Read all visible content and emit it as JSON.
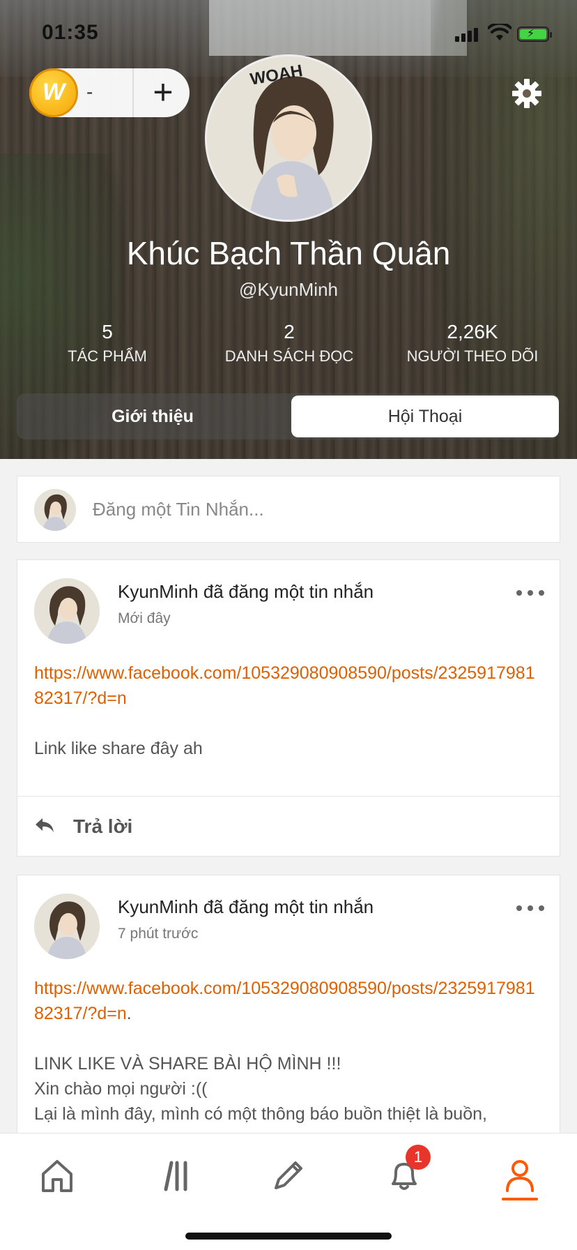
{
  "status_bar": {
    "time": "01:35"
  },
  "wallet": {
    "count": "-",
    "plus": "+",
    "coin_letter": "W"
  },
  "profile": {
    "name": "Khúc Bạch Thần Quân",
    "handle": "@KyunMinh",
    "avatar_caption": "WOAH",
    "stats": [
      {
        "value": "5",
        "label": "TÁC PHẨM"
      },
      {
        "value": "2",
        "label": "DANH SÁCH ĐỌC"
      },
      {
        "value": "2,26K",
        "label": "NGƯỜI THEO DÕI"
      }
    ]
  },
  "tabs": [
    {
      "label": "Giới thiệu",
      "active": false
    },
    {
      "label": "Hội Thoại",
      "active": true
    }
  ],
  "composer": {
    "placeholder": "Đăng một Tin Nhắn..."
  },
  "posts": [
    {
      "title": "KyunMinh đã đăng một tin nhắn",
      "time": "Mới đây",
      "link": "https://www.facebook.com/105329080908590/posts/232591798182317/?d=n",
      "body": "Link like share đây ah",
      "reply_label": "Trả lời"
    },
    {
      "title": "KyunMinh đã đăng một tin nhắn",
      "time": "7 phút trước",
      "link": "https://www.facebook.com/105329080908590/posts/232591798182317/?d=n",
      "link_suffix": ".",
      "body": "LINK LIKE VÀ SHARE BÀI HỘ MÌNH !!!\nXin chào mọi người :((\nLại là mình đây, mình có một thông báo buồn thiệt là buồn,"
    }
  ],
  "nav": {
    "items": [
      "home-icon",
      "library-icon",
      "write-icon",
      "notification-icon",
      "profile-icon"
    ],
    "notification_count": "1",
    "active": "profile",
    "accent": "#ff5a00"
  },
  "colors": {
    "link": "#e06000",
    "badge": "#e8352b",
    "coin": "#f5a600"
  }
}
